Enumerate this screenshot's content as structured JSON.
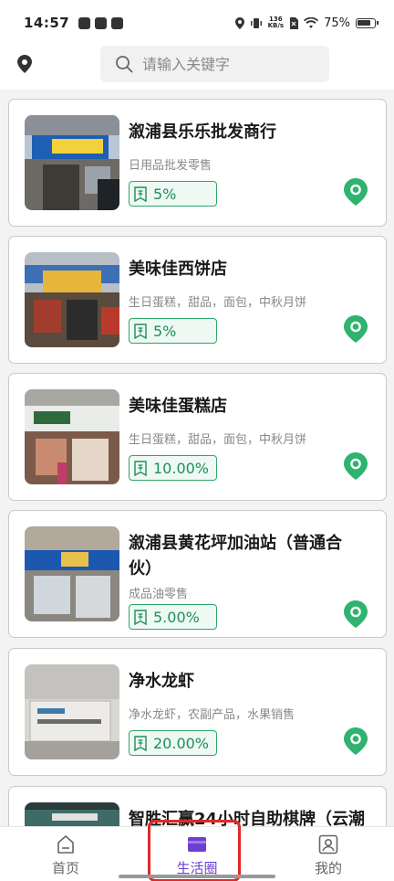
{
  "status_bar": {
    "time": "14:57",
    "network_speed_top": "136",
    "network_speed_bottom": "KB/s",
    "battery": "75%"
  },
  "header": {
    "location_icon": "location-pin-icon",
    "search_placeholder": "请输入关键字",
    "search_icon": "search-icon"
  },
  "stores": [
    {
      "name": "溆浦县乐乐批发商行",
      "category": "日用品批发零售",
      "rate": "5%"
    },
    {
      "name": "美味佳西饼店",
      "category": "生日蛋糕，甜品，面包，中秋月饼",
      "rate": "5%"
    },
    {
      "name": "美味佳蛋糕店",
      "category": "生日蛋糕，甜品，面包，中秋月饼",
      "rate": "10.00%"
    },
    {
      "name": "溆浦县黄花坪加油站（普通合伙）",
      "category": "成品油零售",
      "rate": "5.00%"
    },
    {
      "name": "净水龙虾",
      "category": "净水龙虾，农副产品，水果销售",
      "rate": "20.00%"
    },
    {
      "name": "智胜汇赢24小时自助棋牌（云潮",
      "category": "",
      "rate": ""
    }
  ],
  "colors": {
    "accent_green": "#2fa56a",
    "accent_purple": "#6b3fd1",
    "highlight_red": "#e02828"
  },
  "bottom_nav": {
    "items": [
      {
        "label": "首页",
        "icon": "home-icon",
        "active": false
      },
      {
        "label": "生活圈",
        "icon": "wallet-icon",
        "active": true
      },
      {
        "label": "我的",
        "icon": "profile-icon",
        "active": false
      }
    ]
  }
}
